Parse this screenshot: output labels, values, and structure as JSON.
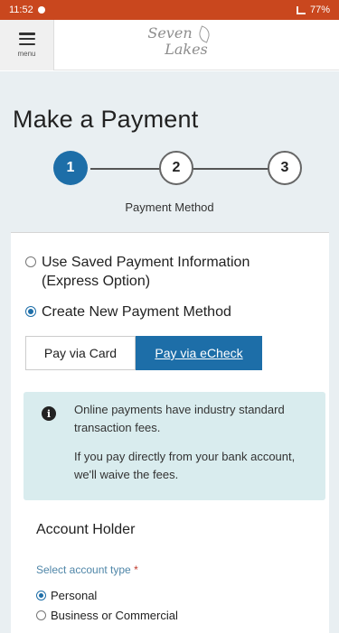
{
  "status_bar": {
    "time": "11:52",
    "right_text": "77%"
  },
  "header": {
    "menu_label": "menu",
    "logo_line1": "Seven",
    "logo_line2": "Lakes"
  },
  "page": {
    "title": "Make a Payment",
    "steps": [
      "1",
      "2",
      "3"
    ],
    "active_step": 1,
    "step_caption": "Payment Method"
  },
  "payment_options": {
    "saved_label_line1": "Use Saved Payment Information",
    "saved_label_line2": "(Express Option)",
    "new_label": "Create New Payment Method",
    "selected": "new"
  },
  "tabs": {
    "card": "Pay via Card",
    "echeck": "Pay via eCheck",
    "active": "echeck"
  },
  "notice": {
    "line1": "Online payments have industry standard transaction fees.",
    "line2": "If you pay directly from your bank account, we'll waive the fees."
  },
  "account_holder": {
    "title": "Account Holder",
    "field_label": "Select account type",
    "required_mark": "*",
    "options": [
      "Personal",
      "Business or Commercial"
    ],
    "selected": "Personal"
  },
  "colors": {
    "status_bar": "#c9471e",
    "accent": "#1d6ea8",
    "page_bg": "#e9eff2",
    "notice_bg": "#d9ecee"
  }
}
